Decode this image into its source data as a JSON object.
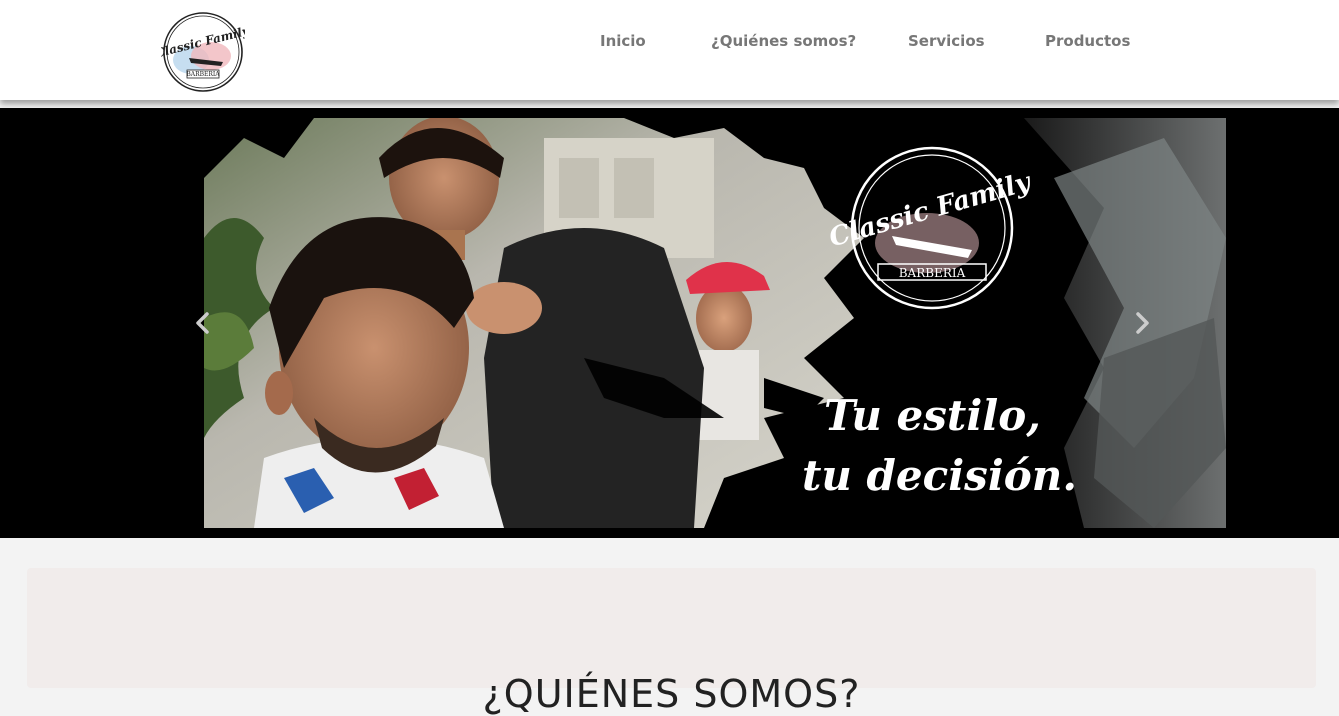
{
  "brand": {
    "logo_top_text": "Classic Family",
    "logo_bottom_text": "BARBERIA"
  },
  "nav": {
    "items": [
      {
        "label": "Inicio"
      },
      {
        "label": "¿Quiénes somos?"
      },
      {
        "label": "Servicios"
      },
      {
        "label": "Productos"
      }
    ],
    "text_color": "#777777"
  },
  "hero": {
    "logo_top_text": "Classic Family",
    "logo_bottom_text": "BARBERIA",
    "slogan_line1": "Tu estilo,",
    "slogan_line2": "tu decisión.",
    "prev_icon": "chevron-left-icon",
    "next_icon": "chevron-right-icon"
  },
  "about": {
    "title": "¿QUIÉNES SOMOS?",
    "background": "#f1eceb"
  }
}
